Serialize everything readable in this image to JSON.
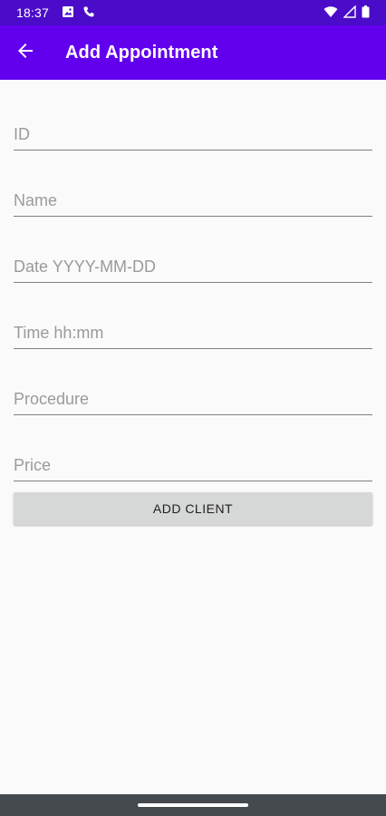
{
  "status_bar": {
    "time": "18:37",
    "icons_left": [
      "image-icon",
      "phone-icon"
    ],
    "icons_right": [
      "wifi-icon",
      "signal-icon",
      "battery-icon"
    ]
  },
  "app_bar": {
    "title": "Add Appointment",
    "back_icon": "arrow-back-icon",
    "background": "#6200ee",
    "status_background": "#4a0cc9"
  },
  "form": {
    "fields": [
      {
        "placeholder": "ID",
        "value": ""
      },
      {
        "placeholder": "Name",
        "value": ""
      },
      {
        "placeholder": "Date YYYY-MM-DD",
        "value": ""
      },
      {
        "placeholder": "Time hh:mm",
        "value": ""
      },
      {
        "placeholder": "Procedure",
        "value": ""
      },
      {
        "placeholder": "Price",
        "value": ""
      }
    ],
    "submit_label": "ADD CLIENT"
  }
}
